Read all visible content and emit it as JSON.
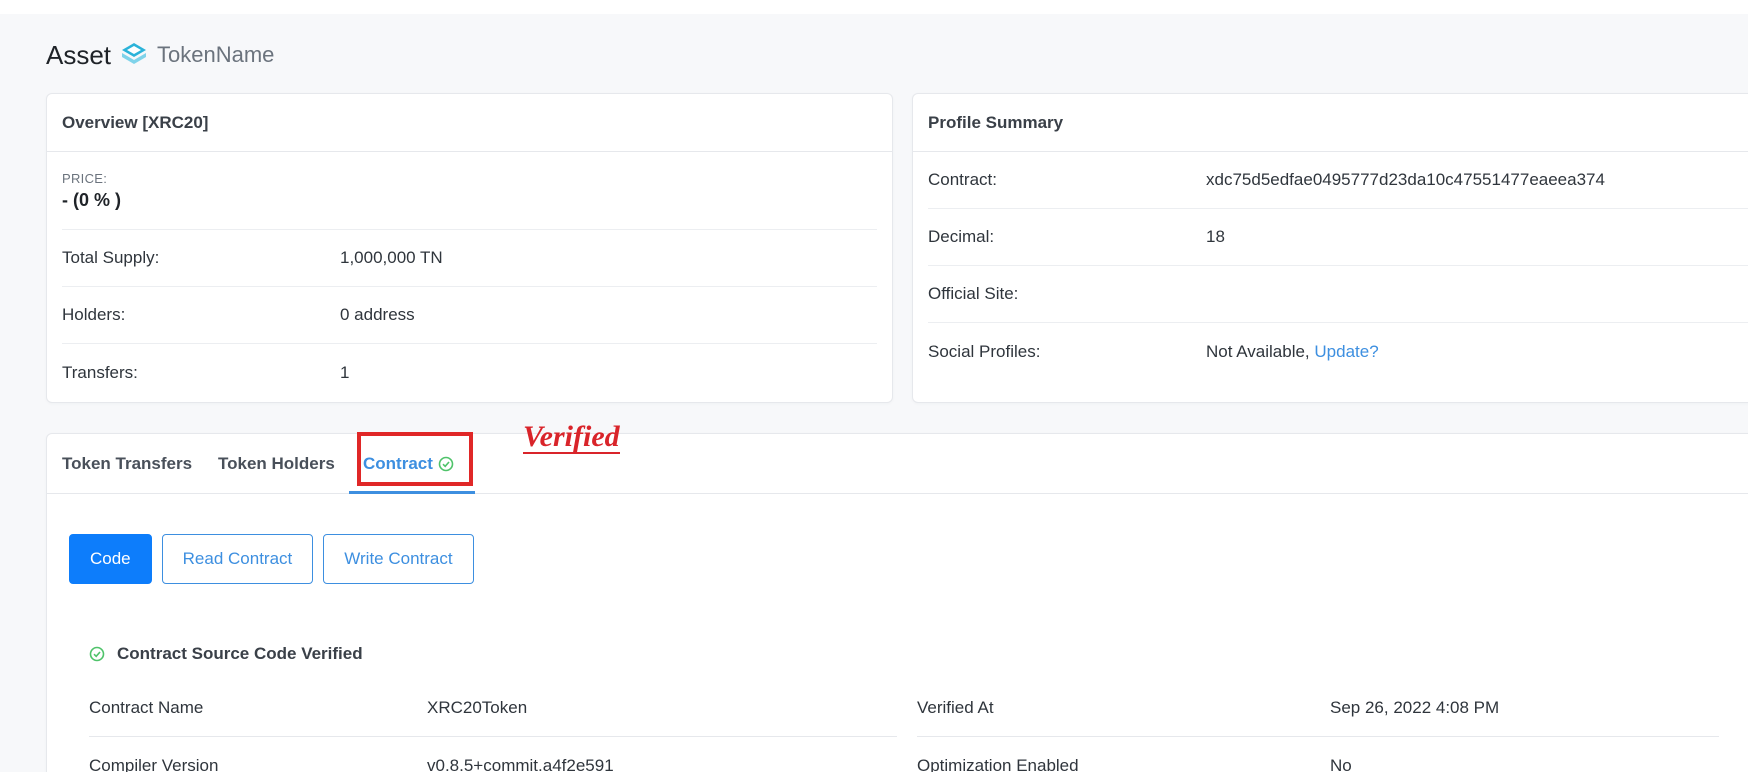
{
  "page": {
    "title": "Asset",
    "token_name": "TokenName"
  },
  "overview": {
    "header": "Overview [XRC20]",
    "price_label": "PRICE:",
    "price_value": "- (0 % )",
    "rows": [
      {
        "label": "Total Supply:",
        "value": "1,000,000 TN"
      },
      {
        "label": "Holders:",
        "value": "0 address"
      },
      {
        "label": "Transfers:",
        "value": "1"
      }
    ]
  },
  "profile": {
    "header": "Profile Summary",
    "contract_label": "Contract:",
    "contract_value": "xdc75d5edfae0495777d23da10c47551477eaeea374",
    "decimal_label": "Decimal:",
    "decimal_value": "18",
    "site_label": "Official Site:",
    "site_value": "",
    "social_label": "Social Profiles:",
    "social_value": "Not Available,",
    "social_link": "Update?"
  },
  "tabs": {
    "items": [
      "Token Transfers",
      "Token Holders",
      "Contract"
    ],
    "active": "Contract",
    "annotation": "Verified"
  },
  "sub_buttons": {
    "code": "Code",
    "read": "Read Contract",
    "write": "Write Contract"
  },
  "contract_info": {
    "verified_text": "Contract Source Code Verified",
    "rows": [
      {
        "left_label": "Contract Name",
        "left_value": "XRC20Token",
        "right_label": "Verified At",
        "right_value": "Sep 26, 2022 4:08 PM"
      },
      {
        "left_label": "Compiler Version",
        "left_value": "v0.8.5+commit.a4f2e591",
        "right_label": "Optimization Enabled",
        "right_value": "No"
      }
    ]
  },
  "colors": {
    "accent": "#3d8fe0",
    "primary_button": "#0d7dfb",
    "success": "#4fc36a",
    "annotation": "#d9242a",
    "token_icon": "#2bb3d9"
  }
}
